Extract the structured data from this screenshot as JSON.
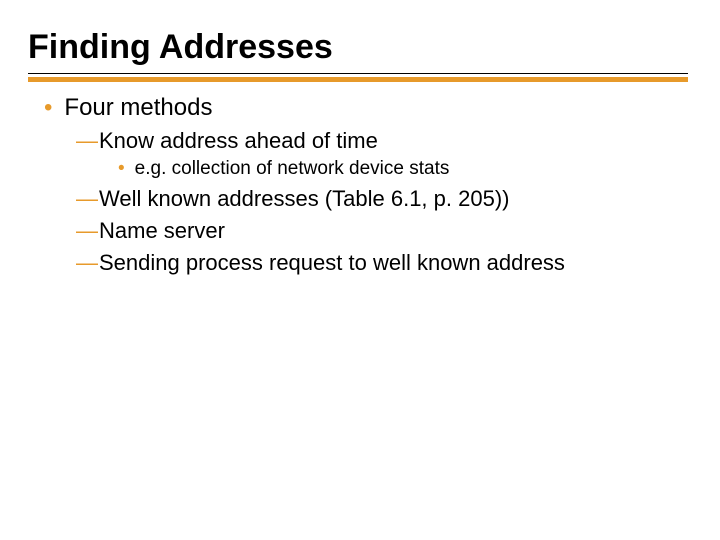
{
  "title": "Finding Addresses",
  "level1": {
    "text": "Four methods"
  },
  "level2": {
    "a": "Know address ahead of time",
    "b": "Well known addresses (Table 6.1, p. 205))",
    "c": "Name server",
    "d": "Sending process request to well known address"
  },
  "level3": {
    "a": "e.g. collection of network device stats"
  }
}
